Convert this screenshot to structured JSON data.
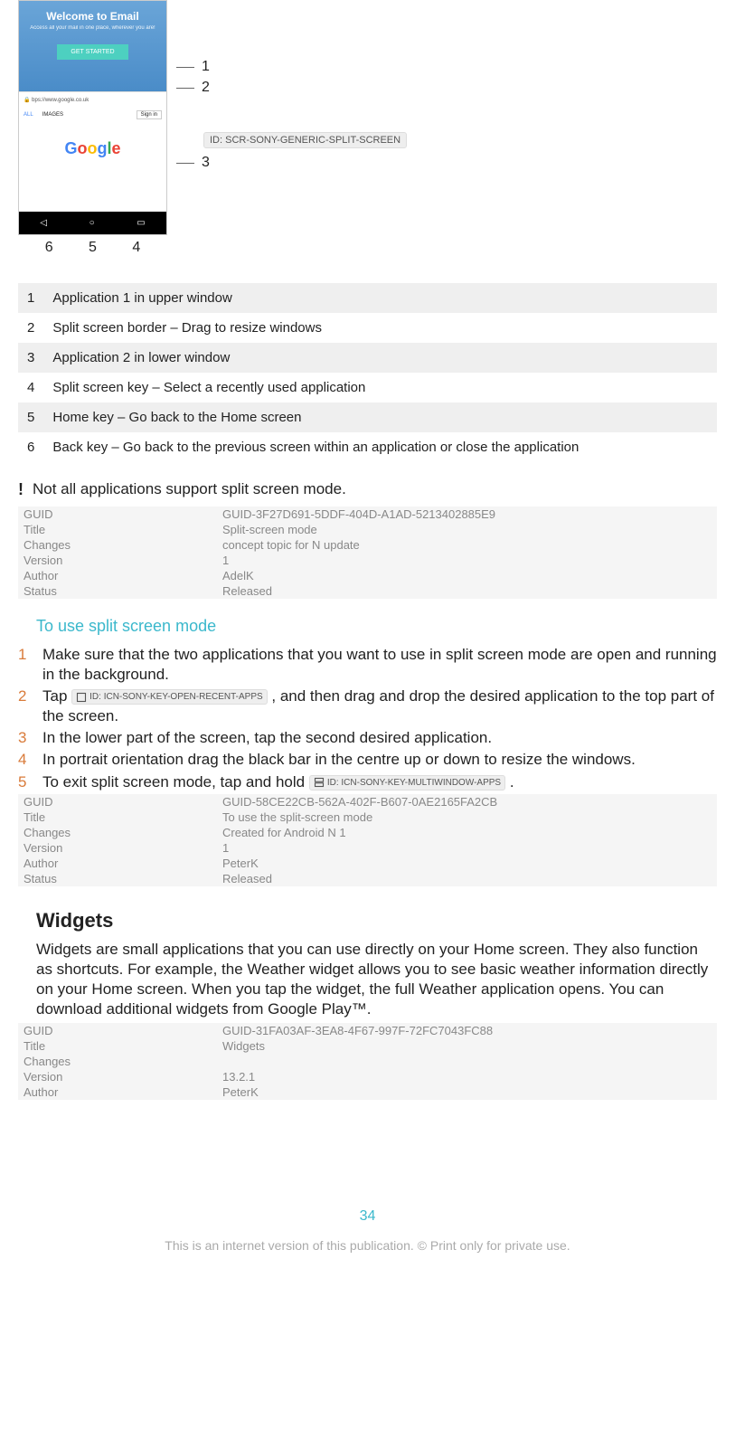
{
  "screenshot": {
    "welcome_title": "Welcome to Email",
    "welcome_sub": "Access all your mail in one place, wherever you are!",
    "welcome_btn": "GET STARTED",
    "url": "bps://www.google.co.uk",
    "tab_all": "ALL",
    "tab_images": "IMAGES",
    "signin": "Sign in",
    "id_label": "ID: SCR-SONY-GENERIC-SPLIT-SCREEN",
    "callout_1": "1",
    "callout_2": "2",
    "callout_3": "3",
    "callout_4": "4",
    "callout_5": "5",
    "callout_6": "6"
  },
  "legend": [
    {
      "n": "1",
      "t": "Application 1 in upper window"
    },
    {
      "n": "2",
      "t": "Split screen border – Drag to resize windows"
    },
    {
      "n": "3",
      "t": "Application 2 in lower window"
    },
    {
      "n": "4",
      "t": "Split screen key – Select a recently used application"
    },
    {
      "n": "5",
      "t": "Home key – Go back to the Home screen"
    },
    {
      "n": "6",
      "t": "Back key – Go back to the previous screen within an application or close the application"
    }
  ],
  "note": {
    "text": "Not all applications support split screen mode."
  },
  "meta1": {
    "guid_l": "GUID",
    "guid_v": "GUID-3F27D691-5DDF-404D-A1AD-5213402885E9",
    "title_l": "Title",
    "title_v": "Split-screen mode",
    "changes_l": "Changes",
    "changes_v": "concept topic for N update",
    "version_l": "Version",
    "version_v": "1",
    "author_l": "Author",
    "author_v": "AdelK",
    "status_l": "Status",
    "status_v": "Released"
  },
  "subheading1": "To use split screen mode",
  "steps": {
    "s1n": "1",
    "s1t": "Make sure that the two applications that you want to use in split screen mode are open and running in the background.",
    "s2n": "2",
    "s2t_a": "Tap ",
    "s2_icon": "ID: ICN-SONY-KEY-OPEN-RECENT-APPS",
    "s2t_b": " , and then drag and drop the desired application to the top part of the screen.",
    "s3n": "3",
    "s3t": "In the lower part of the screen, tap the second desired application.",
    "s4n": "4",
    "s4t": "In portrait orientation drag the black bar in the centre up or down to resize the windows.",
    "s5n": "5",
    "s5t_a": "To exit split screen mode, tap and hold ",
    "s5_icon": "ID: ICN-SONY-KEY-MULTIWINDOW-APPS",
    "s5t_b": " ."
  },
  "meta2": {
    "guid_l": "GUID",
    "guid_v": "GUID-58CE22CB-562A-402F-B607-0AE2165FA2CB",
    "title_l": "Title",
    "title_v": "To use the split-screen mode",
    "changes_l": "Changes",
    "changes_v": "Created for Android N 1",
    "version_l": "Version",
    "version_v": "1",
    "author_l": "Author",
    "author_v": "PeterK",
    "status_l": "Status",
    "status_v": "Released"
  },
  "widgets": {
    "heading": "Widgets",
    "body": "Widgets are small applications that you can use directly on your Home screen. They also function as shortcuts. For example, the Weather widget allows you to see basic weather information directly on your Home screen. When you tap the widget, the full Weather application opens. You can download additional widgets from Google Play™."
  },
  "meta3": {
    "guid_l": "GUID",
    "guid_v": "GUID-31FA03AF-3EA8-4F67-997F-72FC7043FC88",
    "title_l": "Title",
    "title_v": "Widgets",
    "changes_l": "Changes",
    "changes_v": "",
    "version_l": "Version",
    "version_v": "13.2.1",
    "author_l": "Author",
    "author_v": "PeterK"
  },
  "page_number": "34",
  "footer": "This is an internet version of this publication. © Print only for private use."
}
